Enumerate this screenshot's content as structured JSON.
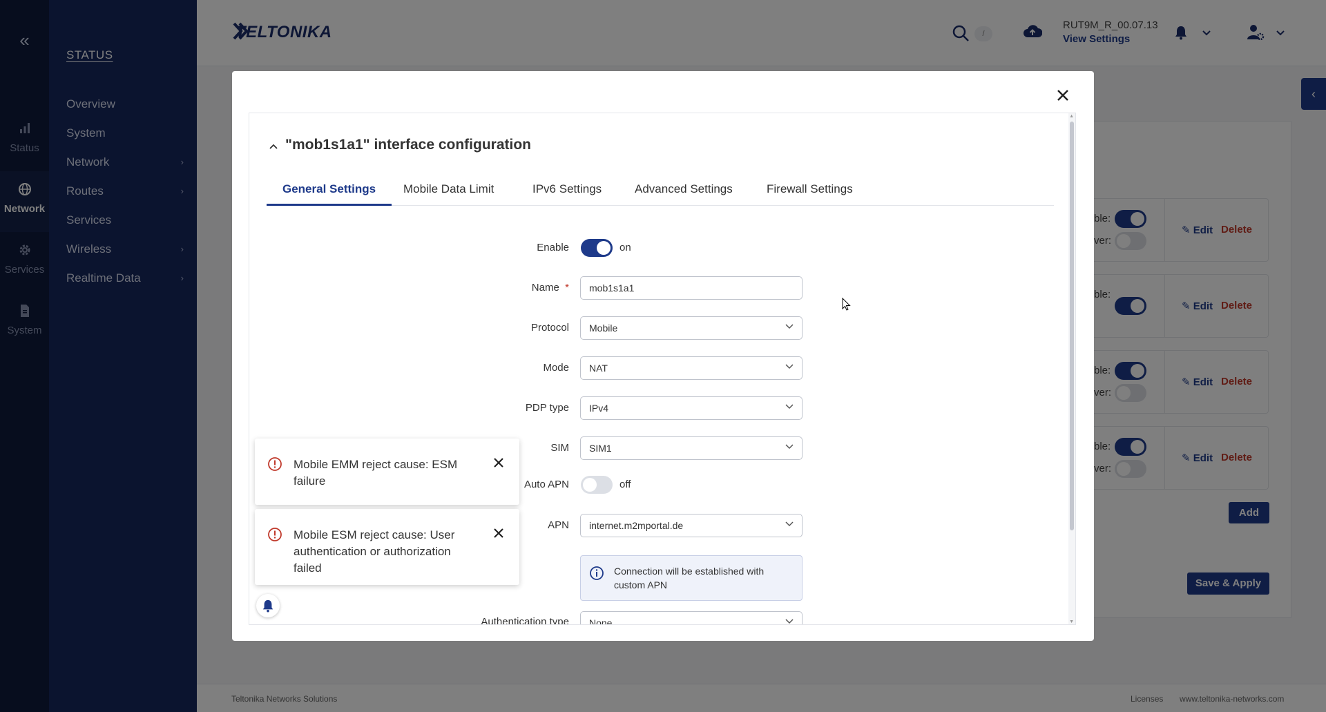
{
  "rail": {
    "items": [
      {
        "label": "Status",
        "icon": "status-icon"
      },
      {
        "label": "Network",
        "icon": "globe-icon"
      },
      {
        "label": "Services",
        "icon": "gear-icon"
      },
      {
        "label": "System",
        "icon": "file-icon"
      }
    ]
  },
  "sidebar": {
    "title": "STATUS",
    "items": [
      {
        "label": "Overview"
      },
      {
        "label": "System"
      },
      {
        "label": "Network"
      },
      {
        "label": "Routes"
      },
      {
        "label": "Services"
      },
      {
        "label": "Wireless"
      },
      {
        "label": "Realtime Data"
      }
    ]
  },
  "header": {
    "logo_text": "TELTONIKA",
    "search_shortcut": "/",
    "firmware": "RUT9M_R_00.07.13",
    "view_settings": "View Settings"
  },
  "background": {
    "cards": [
      {
        "label1": "ble:",
        "label2": "ver:",
        "edit": "Edit",
        "delete": "Delete"
      },
      {
        "label1": "ble:",
        "label2": "",
        "edit": "Edit",
        "delete": "Delete"
      },
      {
        "label1": "ble:",
        "label2": "ver:",
        "edit": "Edit",
        "delete": "Delete"
      },
      {
        "label1": "ble:",
        "label2": "ver:",
        "edit": "Edit",
        "delete": "Delete"
      }
    ],
    "add": "Add",
    "save_apply": "Save & Apply"
  },
  "footer": {
    "left": "Teltonika Networks Solutions",
    "licenses": "Licenses",
    "website": "www.teltonika-networks.com"
  },
  "modal": {
    "title": "\"mob1s1a1\" interface configuration",
    "tabs": [
      {
        "label": "General Settings"
      },
      {
        "label": "Mobile Data Limit"
      },
      {
        "label": "IPv6 Settings"
      },
      {
        "label": "Advanced Settings"
      },
      {
        "label": "Firewall Settings"
      }
    ],
    "form": {
      "enable_label": "Enable",
      "enable_state": "on",
      "name_label": "Name",
      "name_required": "*",
      "name_value": "mob1s1a1",
      "protocol_label": "Protocol",
      "protocol_value": "Mobile",
      "mode_label": "Mode",
      "mode_value": "NAT",
      "pdp_label": "PDP type",
      "pdp_value": "IPv4",
      "sim_label": "SIM",
      "sim_value": "SIM1",
      "auto_apn_label": "Auto APN",
      "auto_apn_state": "off",
      "apn_label": "APN",
      "apn_value": "internet.m2mportal.de",
      "info_text": "Connection will be established with custom APN",
      "auth_label": "Authentication type",
      "auth_value": "None"
    }
  },
  "notifications": [
    {
      "text": "Mobile EMM reject cause: ESM failure"
    },
    {
      "text": "Mobile ESM reject cause: User authentication or authorization failed"
    }
  ],
  "colors": {
    "brand": "#1e3a8a",
    "rail": "#0e1b3d",
    "sidebar": "#17285f",
    "danger": "#c0392b"
  }
}
